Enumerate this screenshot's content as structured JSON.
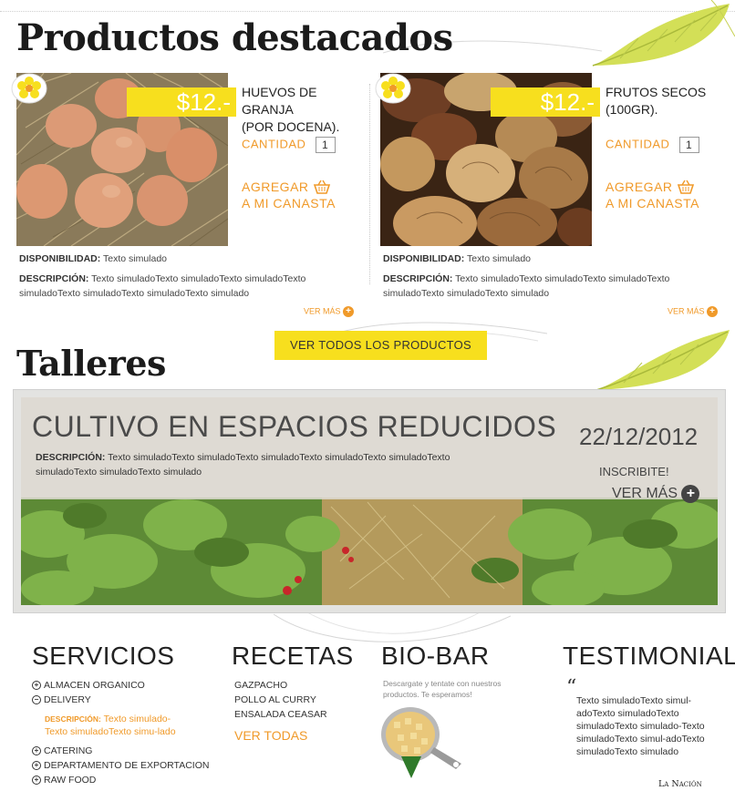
{
  "productos": {
    "title": "Productos destacados",
    "items": [
      {
        "price": "$12.-",
        "name_line1": "HUEVOS DE GRANJA",
        "name_line2": "(POR DOCENA).",
        "qty_label": "CANTIDAD",
        "qty_value": "1",
        "add_line1": "AGREGAR",
        "add_line2": "A MI CANASTA",
        "disp_label": "DISPONIBILIDAD:",
        "disp_value": "Texto simulado",
        "desc_label": "DESCRIPCIÓN:",
        "desc_value": "Texto simuladoTexto simuladoTexto simuladoTexto simuladoTexto simuladoTexto simuladoTexto simulado",
        "more": "VER MÁS"
      },
      {
        "price": "$12.-",
        "name_line1": "FRUTOS SECOS",
        "name_line2": "(100GR).",
        "qty_label": "CANTIDAD",
        "qty_value": "1",
        "add_line1": "AGREGAR",
        "add_line2": "A MI CANASTA",
        "disp_label": "DISPONIBILIDAD:",
        "disp_value": "Texto simulado",
        "desc_label": "DESCRIPCIÓN:",
        "desc_value": "Texto simuladoTexto simuladoTexto simuladoTexto simuladoTexto simuladoTexto simulado",
        "more": "VER MÁS"
      }
    ],
    "see_all": "VER TODOS LOS PRODUCTOS"
  },
  "talleres": {
    "title": "Talleres",
    "workshop": {
      "title": "CULTIVO EN ESPACIOS REDUCIDOS",
      "date": "22/12/2012",
      "desc_label": "DESCRIPCIÓN:",
      "desc_value": "Texto simuladoTexto simuladoTexto simuladoTexto simuladoTexto simuladoTexto simuladoTexto simuladoTexto simulado",
      "signup": "INSCRIBITE!",
      "more": "VER MÁS"
    }
  },
  "servicios": {
    "title": "SERVICIOS",
    "items": [
      "ALMACEN ORGANICO",
      "DELIVERY",
      "CATERING",
      "DEPARTAMENTO DE EXPORTACION",
      "RAW FOOD"
    ],
    "delivery_desc_label": "DESCRIPCIÓN:",
    "delivery_desc_value": "Texto simulado-Texto simuladoTexto simu-lado"
  },
  "recetas": {
    "title": "RECETAS",
    "items": [
      "GAZPACHO",
      "POLLO AL CURRY",
      "ENSALADA CEASAR"
    ],
    "see_all": "VER TODAS"
  },
  "biobar": {
    "title": "BIO-BAR",
    "text": "Descargate y tentate con nuestros productos. Te esperamos!"
  },
  "testimonial": {
    "title": "TESTIMONIAL",
    "quote_mark": "“",
    "text": "Texto simuladoTexto simul-adoTexto simuladoTexto simuladoTexto simulado-Texto simuladoTexto simul-adoTexto simuladoTexto simulado",
    "source": "La Nación"
  },
  "colors": {
    "accent_yellow": "#f7df1e",
    "accent_orange": "#f09a2a",
    "leaf_green": "#c9d94a",
    "text_dark": "#222222"
  },
  "icons": [
    "flower-badge-icon",
    "basket-icon",
    "plus-circle-icon",
    "minus-circle-icon",
    "quote-icon",
    "download-arrow-icon"
  ]
}
